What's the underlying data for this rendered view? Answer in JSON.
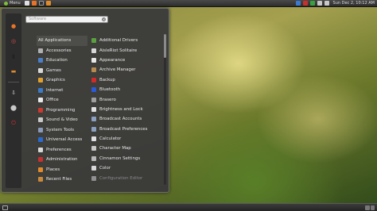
{
  "top_panel": {
    "menu_label": "Menu",
    "clock": "Sun Dec  2, 10:12 AM"
  },
  "menu": {
    "search_placeholder": "Software",
    "favorites": [
      {
        "name": "firefox-icon",
        "glyph": "●",
        "color": "#e8742a"
      },
      {
        "name": "software-manager-icon",
        "glyph": "◎",
        "color": "#d04a4a"
      },
      {
        "name": "terminal-icon",
        "glyph": "▮",
        "color": "#222222"
      },
      {
        "name": "files-icon",
        "glyph": "▬",
        "color": "#e08a2c"
      },
      {
        "name": "logout-icon",
        "glyph": "⇩",
        "color": "#dcdcdc"
      },
      {
        "name": "lock-screen-icon",
        "glyph": "⬤",
        "color": "#c8c8c8"
      },
      {
        "name": "power-icon",
        "glyph": "⏻",
        "color": "#d6302c"
      }
    ],
    "categories": [
      {
        "label": "All Applications",
        "icon_color": "none",
        "selected": true
      },
      {
        "label": "Accessories",
        "icon_color": "#b0b0b0"
      },
      {
        "label": "Education",
        "icon_color": "#4a7fc8"
      },
      {
        "label": "Games",
        "icon_color": "#d8d8d8"
      },
      {
        "label": "Graphics",
        "icon_color": "#e0a030"
      },
      {
        "label": "Internet",
        "icon_color": "#3a7ac8"
      },
      {
        "label": "Office",
        "icon_color": "#e8e8e8"
      },
      {
        "label": "Programming",
        "icon_color": "#c83a30"
      },
      {
        "label": "Sound & Video",
        "icon_color": "#c8c8c8"
      },
      {
        "label": "System Tools",
        "icon_color": "#8a9ab8"
      },
      {
        "label": "Universal Access",
        "icon_color": "#2a6ad0"
      },
      {
        "label": "Preferences",
        "icon_color": "#d8d8d8"
      },
      {
        "label": "Administration",
        "icon_color": "#c83030"
      },
      {
        "label": "Places",
        "icon_color": "#e08a2c"
      },
      {
        "label": "Recent Files",
        "icon_color": "#c88a3a"
      }
    ],
    "applications": [
      {
        "label": "Additional Drivers",
        "icon_color": "#5aa040"
      },
      {
        "label": "AisleRiot Solitaire",
        "icon_color": "#d8d8d8"
      },
      {
        "label": "Appearance",
        "icon_color": "#e8e8e8"
      },
      {
        "label": "Archive Manager",
        "icon_color": "#b88a50"
      },
      {
        "label": "Backup",
        "icon_color": "#d02a2a"
      },
      {
        "label": "Bluetooth",
        "icon_color": "#2a5ad8"
      },
      {
        "label": "Brasero",
        "icon_color": "#a0a0a0"
      },
      {
        "label": "Brightness and Lock",
        "icon_color": "#e0e0e0"
      },
      {
        "label": "Broadcast Accounts",
        "icon_color": "#8aa0c0"
      },
      {
        "label": "Broadcast Preferences",
        "icon_color": "#8aa0c0"
      },
      {
        "label": "Calculator",
        "icon_color": "#e0e0e0"
      },
      {
        "label": "Character Map",
        "icon_color": "#c8c8c8"
      },
      {
        "label": "Cinnamon Settings",
        "icon_color": "#b8b8b8"
      },
      {
        "label": "Color",
        "icon_color": "#d8d8d8"
      },
      {
        "label": "Configuration Editor",
        "icon_color": "#909090",
        "dimmed": true
      }
    ]
  }
}
